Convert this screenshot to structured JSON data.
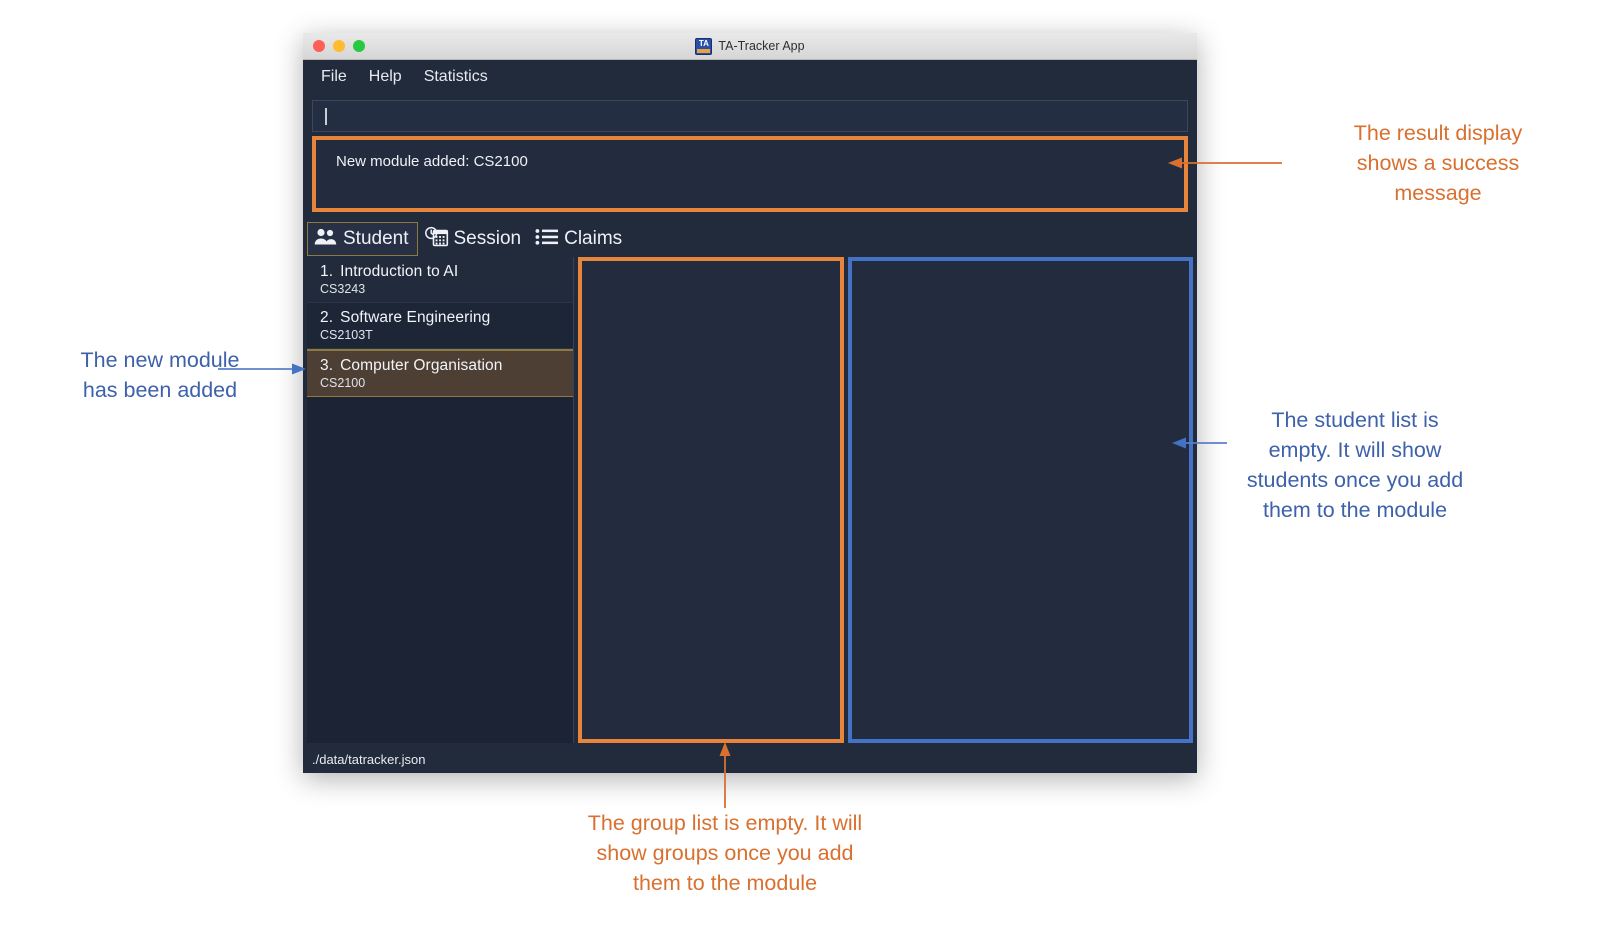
{
  "window": {
    "title": "TA-Tracker App",
    "app_icon": "ta-tracker-icon",
    "traffic_lights": [
      "close",
      "minimize",
      "zoom"
    ]
  },
  "menubar": {
    "items": [
      {
        "label": "File"
      },
      {
        "label": "Help"
      },
      {
        "label": "Statistics"
      }
    ]
  },
  "command_box": {
    "value": "",
    "placeholder": ""
  },
  "result_display": {
    "message": "New module added: CS2100",
    "border_color": "#e8853c"
  },
  "tabs": [
    {
      "label": "Student",
      "icon": "people-icon",
      "selected": true
    },
    {
      "label": "Session",
      "icon": "calendar-clock-icon",
      "selected": false
    },
    {
      "label": "Claims",
      "icon": "list-icon",
      "selected": false
    }
  ],
  "module_list": {
    "items": [
      {
        "index": "1.",
        "name": "Introduction to AI",
        "code": "CS3243",
        "selected": false
      },
      {
        "index": "2.",
        "name": "Software Engineering",
        "code": "CS2103T",
        "selected": false
      },
      {
        "index": "3.",
        "name": "Computer Organisation",
        "code": "CS2100",
        "selected": true
      }
    ]
  },
  "group_pane": {
    "items": [],
    "border_color": "#e8853c"
  },
  "student_pane": {
    "items": [],
    "border_color": "#4472c4"
  },
  "statusbar": {
    "file_path": "./data/tatracker.json"
  },
  "annotations": [
    {
      "id": "result-display-note",
      "color": "#d9702f",
      "lines": [
        "The result display",
        "shows a success",
        "message"
      ]
    },
    {
      "id": "new-module-note",
      "color": "#3d61ab",
      "lines": [
        "The new module",
        "has been added"
      ]
    },
    {
      "id": "student-list-note",
      "color": "#3d61ab",
      "lines": [
        "The student list is",
        "empty. It will show",
        "students once you add",
        "them to the module"
      ]
    },
    {
      "id": "group-list-note",
      "color": "#d9702f",
      "lines": [
        "The group list is empty. It will",
        "show groups once you add",
        "them to the module"
      ]
    }
  ]
}
